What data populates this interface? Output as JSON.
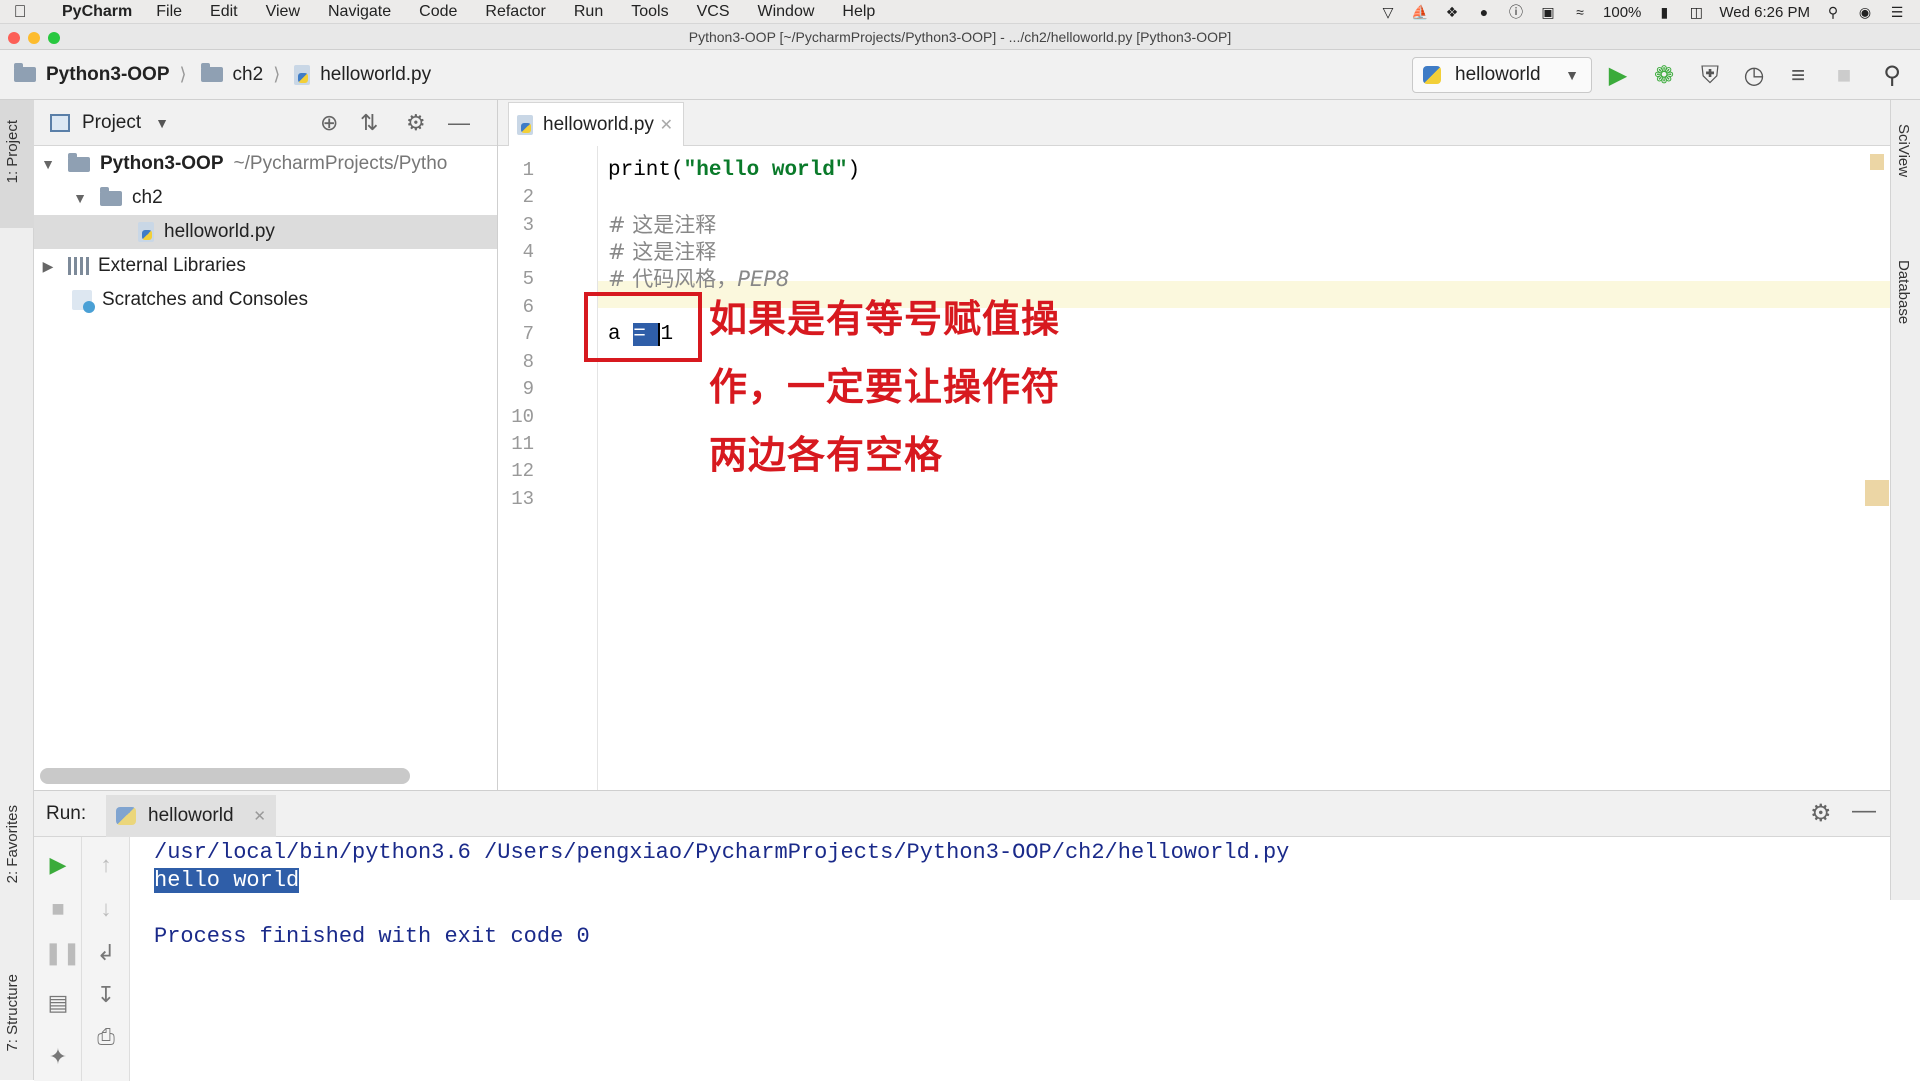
{
  "menubar": {
    "app": "PyCharm",
    "items": [
      "File",
      "Edit",
      "View",
      "Navigate",
      "Code",
      "Refactor",
      "Run",
      "Tools",
      "VCS",
      "Window",
      "Help"
    ],
    "battery": "100%",
    "clock": "Wed 6:26 PM"
  },
  "window": {
    "title": "Python3-OOP [~/PycharmProjects/Python3-OOP] - .../ch2/helloworld.py [Python3-OOP]"
  },
  "navbar": {
    "breadcrumbs": [
      "Python3-OOP",
      "ch2",
      "helloworld.py"
    ],
    "run_config": "helloworld"
  },
  "left_stripe": {
    "project_tab": "1: Project",
    "favorites_tab": "2: Favorites",
    "structure_tab": "7: Structure"
  },
  "right_stripe": {
    "sciview_tab": "SciView",
    "database_tab": "Database"
  },
  "project": {
    "header": "Project",
    "tree": [
      {
        "label": "Python3-OOP",
        "path": "~/PycharmProjects/Pytho"
      },
      {
        "label": "ch2"
      },
      {
        "label": "helloworld.py"
      },
      {
        "label": "External Libraries"
      },
      {
        "label": "Scratches and Consoles"
      }
    ]
  },
  "editor": {
    "tab": "helloworld.py",
    "line_numbers": [
      "1",
      "2",
      "3",
      "4",
      "5",
      "6",
      "7",
      "8",
      "9",
      "10",
      "11",
      "12",
      "13"
    ],
    "lines": {
      "l1_func": "print(",
      "l1_str": "\"hello world\"",
      "l1_end": ")",
      "l3": "# 这是注释",
      "l4": "# 这是注释",
      "l5_prefix": "# 代码风格，",
      "l5_em": "PEP8",
      "l7_var": "a ",
      "l7_sel": "= ",
      "l7_rest": "1"
    },
    "annotation": [
      "如果是有等号赋值操",
      "作，一定要让操作符",
      "两边各有空格"
    ]
  },
  "run": {
    "label": "Run:",
    "tab": "helloworld",
    "console": {
      "cmd": "/usr/local/bin/python3.6 /Users/pengxiao/PycharmProjects/Python3-OOP/ch2/helloworld.py",
      "output": "hello world",
      "exit": "Process finished with exit code 0"
    }
  },
  "colors": {
    "annotation_red": "#d7191f",
    "selection_blue": "#2f5ea8",
    "string_green": "#0a7a2a",
    "run_green": "#3bab3b"
  }
}
